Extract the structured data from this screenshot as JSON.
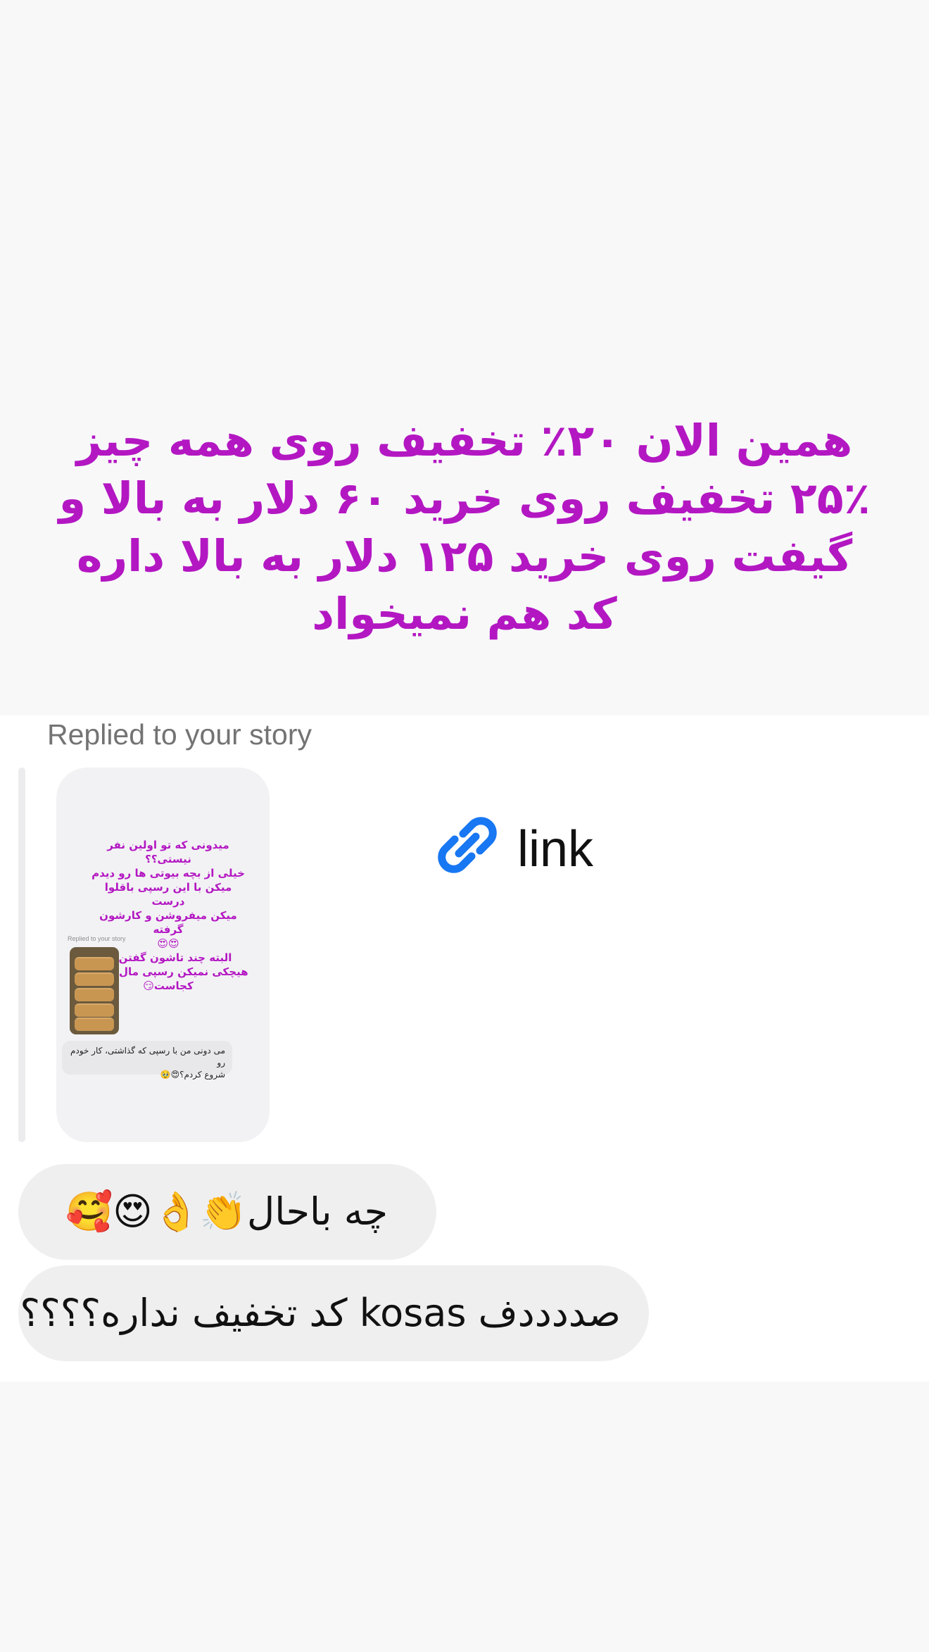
{
  "story": {
    "text": "همین الان ۲۰٪ تخفیف روی همه چیز\n۲۵٪ تخفیف روی خرید ۶۰ دلار به بالا و\nگیفت روی خرید ۱۲۵ دلار به بالا داره\nکد هم نمیخواد",
    "text_color": "#b317c2"
  },
  "reply": {
    "label": "Replied to your story",
    "card": {
      "story_text": "میدونی که تو اولین نفر نیستی؟؟\nخیلی از بچه بیوتی ها رو دیدم\nمیکن با این رسپی باقلوا درست\nمیکن میفروشن و کارشون گرفته\n😍😍\nالبته چند تاشون گفتن به\nهیچکی نمیکن رسپی مال کی و\nکجاست😏",
      "replied_label": "Replied to your story",
      "message_text": "می دونی من با رسپی که گذاشتی، کار خودم رو\nشروع کردم؟😍🥹",
      "thumbnail_icon": "baklava-photo"
    }
  },
  "link": {
    "icon": "link-icon",
    "label": "link",
    "icon_color": "#1877f2"
  },
  "messages": [
    {
      "text": "چه باحال👏👌😍🥰"
    },
    {
      "text": "صددددف kosas  کد تخفیف نداره؟؟؟؟"
    }
  ]
}
